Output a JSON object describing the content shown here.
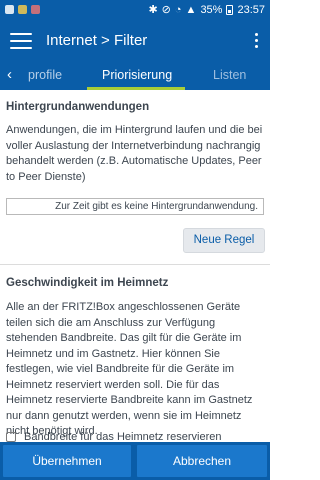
{
  "status_bar": {
    "battery": "35%",
    "time": "23:57"
  },
  "app_bar": {
    "title": "Internet > Filter"
  },
  "tabs": {
    "items": [
      {
        "label": "profile"
      },
      {
        "label": "Priorisierung",
        "active": true
      },
      {
        "label": "Listen"
      }
    ]
  },
  "background_apps": {
    "heading": "Hintergrundanwendungen",
    "description": "Anwendungen, die im Hintergrund laufen und die bei voller Auslastung der Internetverbindung nachrangig behandelt werden (z.B. Automatische Updates, Peer to Peer Dienste)",
    "empty_notice": "Zur Zeit gibt es keine Hintergrundanwendung.",
    "new_rule_label": "Neue Regel"
  },
  "home_network": {
    "heading": "Geschwindigkeit im Heimnetz",
    "description": "Alle an der FRITZ!Box angeschlossenen Geräte teilen sich die am Anschluss zur Verfügung stehenden Bandbreite. Das gilt für die Geräte im Heimnetz und im Gastnetz. Hier können Sie festlegen, wie viel Bandbreite für die Geräte im Heimnetz reserviert werden soll. Die für das Heimnetz reservierte Bandbreite kann im Gastnetz nur dann genutzt werden, wenn sie im Heimnetz nicht benötigt wird.",
    "checkbox_label": "Bandbreite für das Heimnetz reservieren"
  },
  "bottom_bar": {
    "apply_label": "Übernehmen",
    "cancel_label": "Abbrechen"
  },
  "colors": {
    "primary": "#0a5da8",
    "button": "#1b78cc",
    "tab_indicator": "#a9cd37"
  }
}
